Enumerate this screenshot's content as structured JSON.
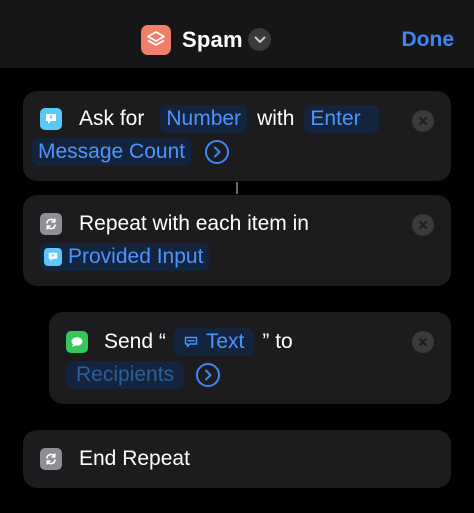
{
  "header": {
    "title": "Spam",
    "done_label": "Done",
    "app_icon": "layers-icon",
    "accent": "#3d86f7"
  },
  "actions": {
    "ask": {
      "icon": "speech-bubble-icon",
      "text_ask": "Ask for",
      "token_type": "Number",
      "text_with": "with",
      "token_prompt": "Enter",
      "token_prompt_cont": "Message Count"
    },
    "repeat": {
      "icon": "repeat-icon",
      "text": "Repeat with each item in",
      "token": "Provided Input"
    },
    "send": {
      "icon": "message-icon",
      "text_send": "Send “",
      "token_text": "Text",
      "text_to": "” to",
      "token_recipients": "Recipients"
    },
    "end_repeat": {
      "icon": "repeat-icon",
      "text": "End Repeat"
    }
  }
}
